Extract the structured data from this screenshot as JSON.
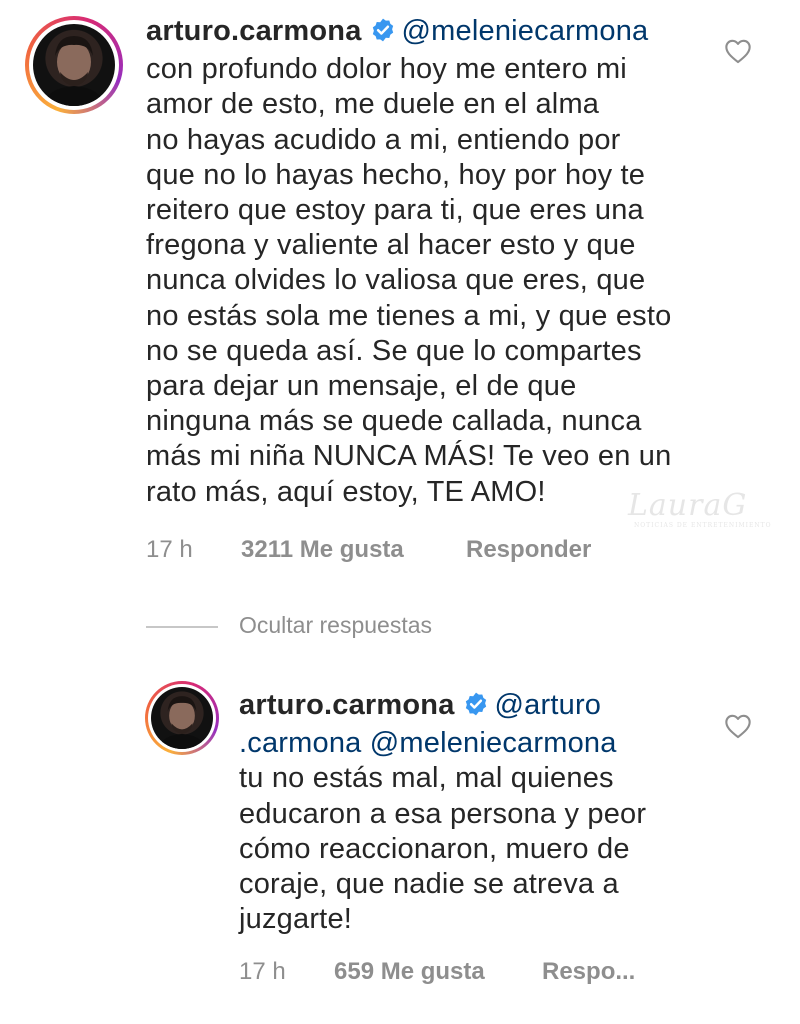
{
  "comment1": {
    "username": "arturo.carmona",
    "mention": "@meleniecarmona",
    "lines": [
      "con profundo dolor hoy me entero mi",
      "amor de esto, me duele en el alma",
      "no hayas acudido a mi, entiendo por",
      "que no lo hayas hecho, hoy por hoy te",
      "reitero que estoy para ti, que eres una",
      "fregona y valiente al hacer esto y que",
      "nunca olvides lo valiosa que eres, que",
      "no estás sola me tienes a mi, y que esto",
      "no se queda así. Se que lo compartes",
      "para dejar un mensaje, el de que",
      "ninguna más se quede callada, nunca",
      "más mi niña NUNCA MÁS! Te veo en un",
      "rato más, aquí estoy, TE AMO!"
    ],
    "time": "17 h",
    "likes": "3211 Me gusta",
    "reply": "Responder"
  },
  "hide_replies": "Ocultar respuestas",
  "comment2": {
    "username": "arturo.carmona",
    "mention1_part1": "@arturo",
    "mention1_part2": ".carmona",
    "mention2": "@meleniecarmona",
    "lines": [
      "tu no estás mal, mal quienes",
      "educaron a esa persona y peor",
      "cómo reaccionaron, muero de",
      "coraje, que nadie se atreva a",
      "juzgarte!"
    ],
    "time": "17 h",
    "likes": "659 Me gusta",
    "reply": "Respo..."
  },
  "watermark": {
    "name": "LauraG",
    "tagline": "NOTICIAS DE ENTRETENIMIENTO"
  },
  "icons": {
    "verified": "verified-badge-icon",
    "heart": "heart-outline-icon"
  },
  "colors": {
    "text": "#262626",
    "mention": "#00376b",
    "muted": "#8e8e8e",
    "verified": "#3897f0"
  }
}
